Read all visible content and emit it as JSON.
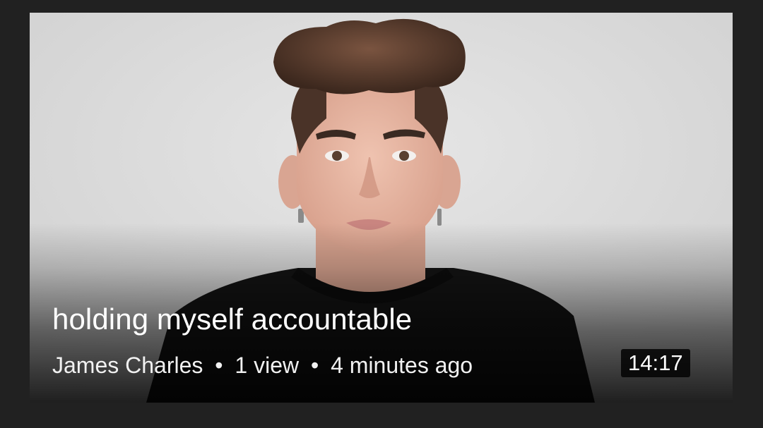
{
  "video": {
    "title": "holding myself accountable",
    "channel": "James Charles",
    "separator": "•",
    "views": "1 view",
    "uploaded": "4 minutes ago",
    "duration": "14:17"
  },
  "colors": {
    "page_background": "#212121",
    "thumbnail_background": "#dcdcdc",
    "text": "#ffffff",
    "duration_badge": "#000000"
  },
  "icons": []
}
